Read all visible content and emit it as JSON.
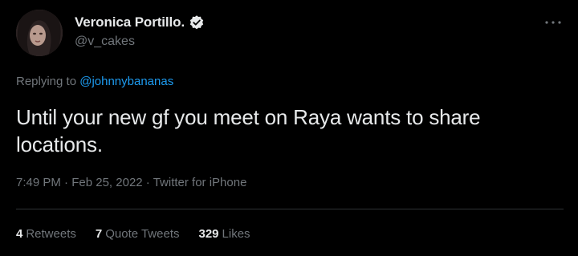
{
  "user": {
    "display_name": "Veronica Portillo.",
    "handle": "@v_cakes",
    "verified": true
  },
  "reply": {
    "prefix": "Replying to ",
    "handle": "@johnnybananas"
  },
  "tweet": {
    "text": "Until your new gf you meet on Raya wants to share locations."
  },
  "meta": {
    "time": "7:49 PM",
    "separator": " · ",
    "date": "Feb 25, 2022",
    "source": "Twitter for iPhone"
  },
  "stats": [
    {
      "count": "4",
      "label": "Retweets"
    },
    {
      "count": "7",
      "label": "Quote Tweets"
    },
    {
      "count": "329",
      "label": "Likes"
    }
  ],
  "colors": {
    "background": "#000000",
    "text": "#e7e9ea",
    "muted": "#71767b",
    "link": "#1d9bf0",
    "divider": "#2f3336"
  },
  "icons": {
    "verified": "verified-badge-icon",
    "more": "more-options-icon"
  }
}
